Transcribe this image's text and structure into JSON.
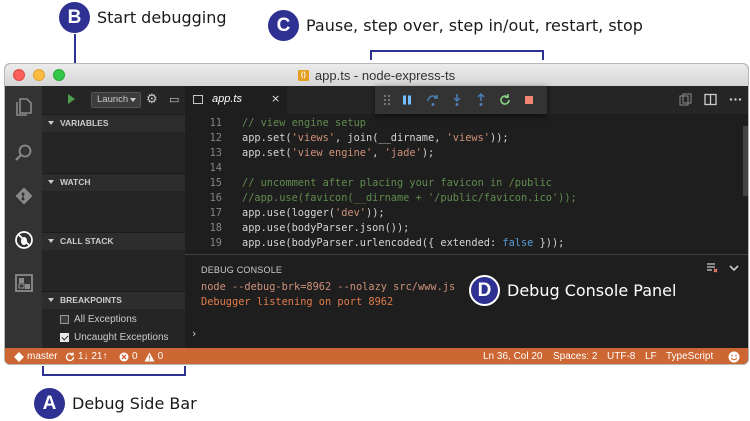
{
  "callouts": {
    "a": {
      "letter": "A",
      "text": "Debug Side Bar"
    },
    "b": {
      "letter": "B",
      "text": "Start debugging"
    },
    "c": {
      "letter": "C",
      "text": "Pause, step over, step in/out, restart, stop"
    },
    "d": {
      "letter": "D",
      "text": "Debug Console Panel"
    }
  },
  "window": {
    "title": "app.ts - node-express-ts"
  },
  "activity_bar": [
    "explorer-icon",
    "search-icon",
    "git-icon",
    "debug-icon",
    "extensions-icon"
  ],
  "sidebar": {
    "launch_config": "Launch",
    "sections": {
      "variables": "VARIABLES",
      "watch": "WATCH",
      "call_stack": "CALL STACK",
      "breakpoints": "BREAKPOINTS"
    },
    "breakpoints": [
      {
        "label": "All Exceptions",
        "checked": false
      },
      {
        "label": "Uncaught Exceptions",
        "checked": true
      }
    ]
  },
  "editor": {
    "tab": {
      "label": "app.ts",
      "close": "×"
    },
    "lines": [
      {
        "n": "11",
        "text": "// view engine setup"
      },
      {
        "n": "12",
        "text": "app.set('views', join(__dirname, 'views'));"
      },
      {
        "n": "13",
        "text": "app.set('view engine', 'jade');"
      },
      {
        "n": "14",
        "text": ""
      },
      {
        "n": "15",
        "text": "// uncomment after placing your favicon in /public"
      },
      {
        "n": "16",
        "text": "//app.use(favicon(__dirname + '/public/favicon.ico'));"
      },
      {
        "n": "17",
        "text": "app.use(logger('dev'));"
      },
      {
        "n": "18",
        "text": "app.use(bodyParser.json());"
      },
      {
        "n": "19",
        "text": "app.use(bodyParser.urlencoded({ extended: false }));"
      }
    ]
  },
  "debug_toolbar": [
    "pause-icon",
    "step-over-icon",
    "step-into-icon",
    "step-out-icon",
    "restart-icon",
    "stop-icon"
  ],
  "panel": {
    "title": "DEBUG CONSOLE",
    "lines": [
      {
        "text": "node --debug-brk=8962 --nolazy src/www.js",
        "color": "#ce9178"
      },
      {
        "text": "Debugger listening on port 8962",
        "color": "#e07b4a"
      }
    ]
  },
  "statusbar": {
    "branch": "master",
    "sync": "1↓ 21↑",
    "errors": "0",
    "warnings": "0",
    "position": "Ln 36, Col 20",
    "spaces": "Spaces: 2",
    "encoding": "UTF-8",
    "eol": "LF",
    "language": "TypeScript"
  },
  "colors": {
    "accent": "#2e3191",
    "statusbar": "#cc6633",
    "comment": "#608b4e",
    "string": "#ce9178"
  }
}
